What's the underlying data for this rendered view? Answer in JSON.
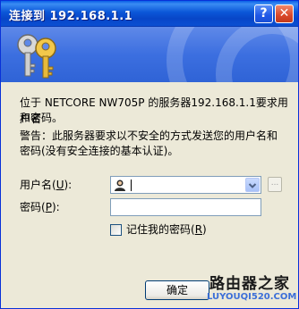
{
  "window": {
    "title": "连接到 192.168.1.1",
    "help_glyph": "?",
    "close_glyph": "✕"
  },
  "message": {
    "line1": "位于 NETCORE NW705P 的服务器192.168.1.1要求用户名",
    "line2": "和密码。",
    "warning_line1": "警告：此服务器要求以不安全的方式发送您的用户名和",
    "warning_line2": "密码(没有安全连接的基本认证)。"
  },
  "form": {
    "username_label": "用户名",
    "username_hotkey": "U",
    "username_value": "",
    "password_label": "密码",
    "password_hotkey": "P",
    "password_value": "",
    "browse_glyph": "...",
    "remember_label": "记住我的密码",
    "remember_hotkey": "R",
    "remember_checked": false
  },
  "buttons": {
    "ok_label": "确定"
  },
  "watermark": {
    "name": "路由器之家",
    "url": "LUYOUQI520.COM"
  }
}
